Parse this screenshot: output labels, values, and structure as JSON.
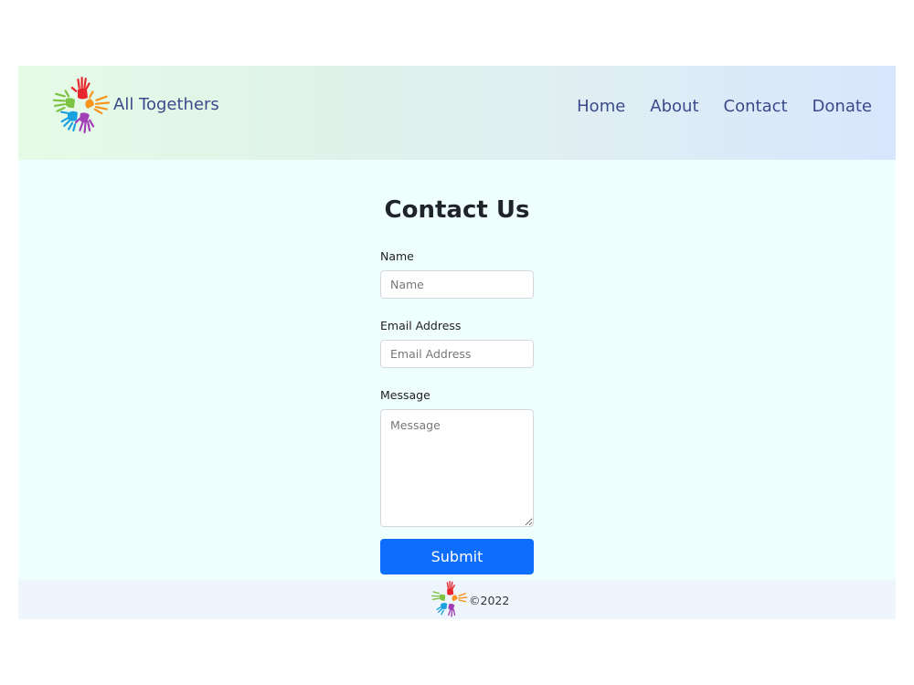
{
  "brand": {
    "name": "All Togethers",
    "logo_icon": "colorful-hands-logo-icon"
  },
  "nav": {
    "items": [
      {
        "label": "Home"
      },
      {
        "label": "About"
      },
      {
        "label": "Contact"
      },
      {
        "label": "Donate"
      }
    ]
  },
  "main": {
    "title": "Contact Us",
    "form": {
      "name_label": "Name",
      "name_placeholder": "Name",
      "email_label": "Email Address",
      "email_placeholder": "Email Address",
      "message_label": "Message",
      "message_placeholder": "Message",
      "submit_label": "Submit"
    }
  },
  "footer": {
    "copyright": "©2022",
    "logo_icon": "colorful-hands-logo-icon"
  },
  "colors": {
    "nav_text": "#3a4a8a",
    "main_bg": "#effffd",
    "footer_bg": "#eef5fc",
    "primary_button": "#0d6efd"
  }
}
